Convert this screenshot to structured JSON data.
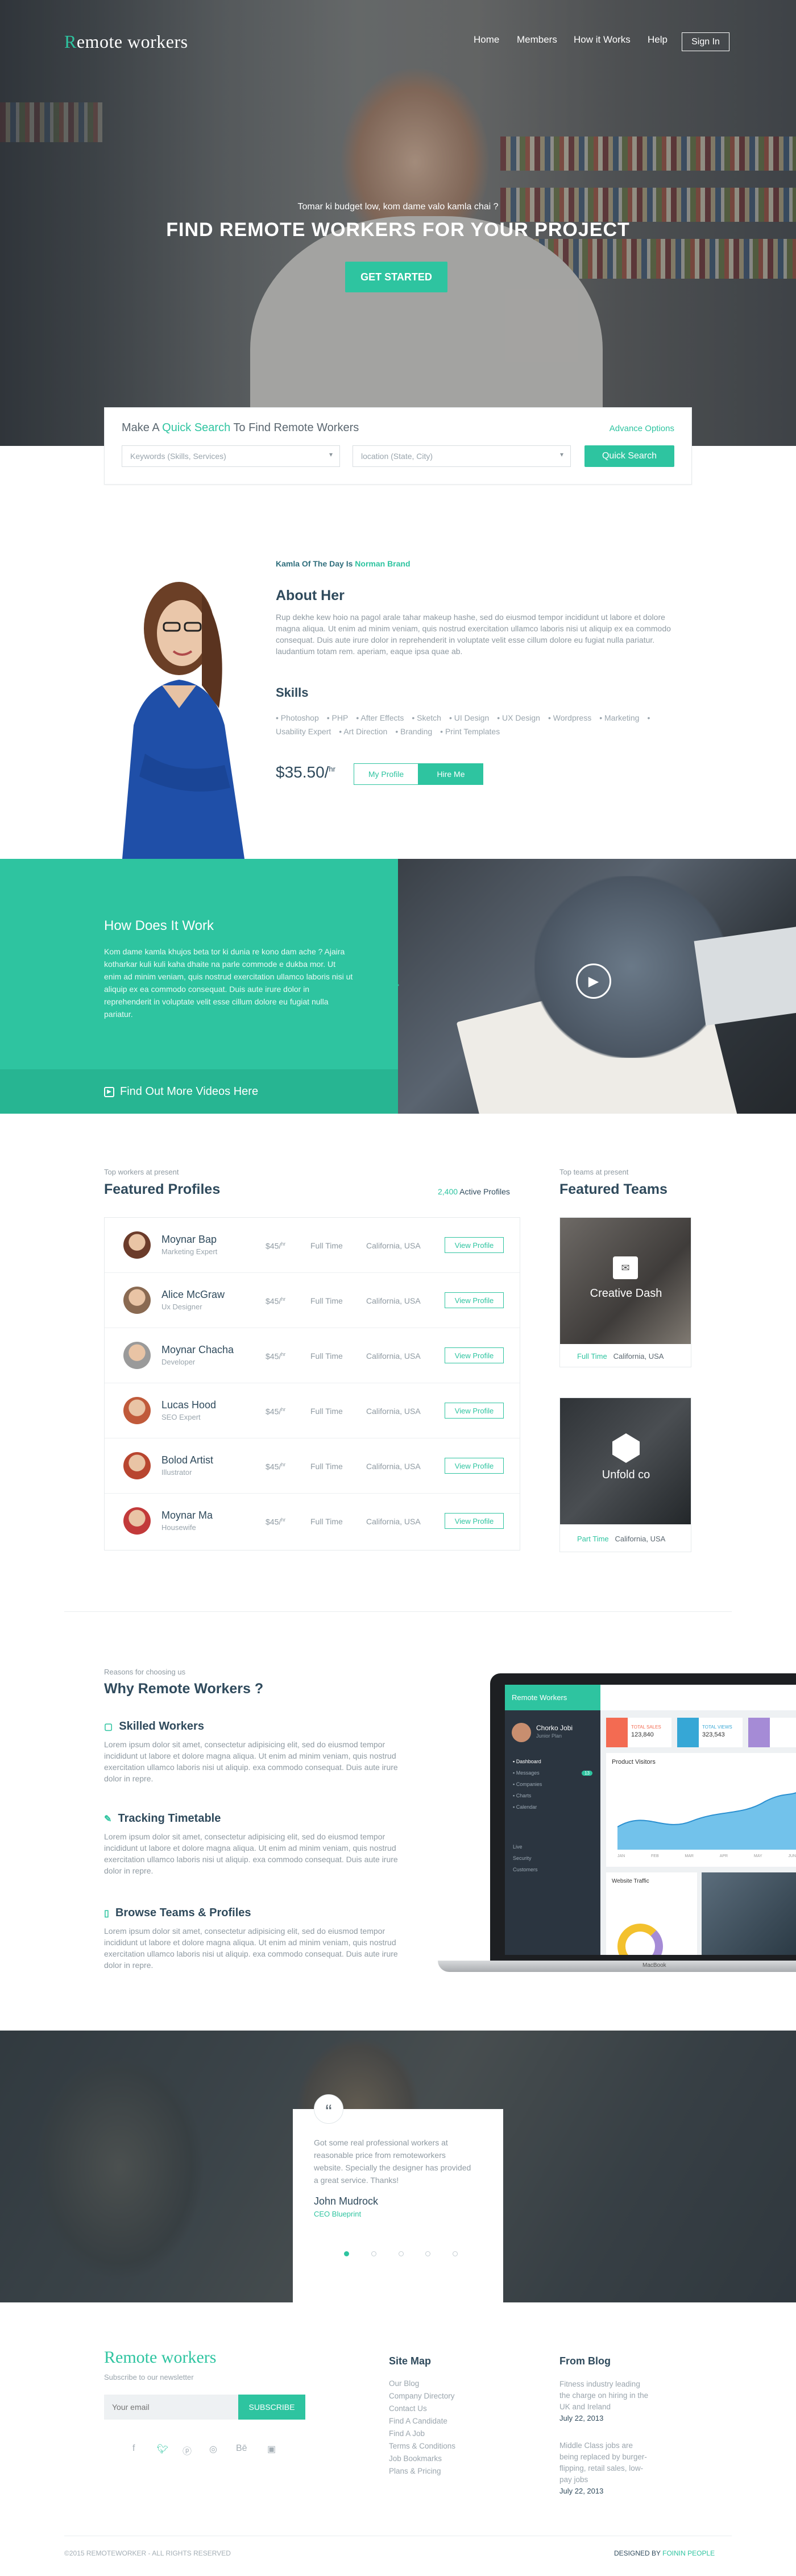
{
  "brand": {
    "first_letter": "R",
    "rest": "emote workers",
    "accent": "#2ec4a0",
    "dark": "#2f4a5c"
  },
  "nav": {
    "home": "Home",
    "members": "Members",
    "how": "How it Works",
    "help": "Help",
    "signin": "Sign In"
  },
  "hero": {
    "subtitle": "Tomar ki budget low, kom dame valo kamla chai ?",
    "title": "FIND REMOTE WORKERS FOR YOUR PROJECT",
    "cta": "GET STARTED"
  },
  "search": {
    "title_pre": "Make A ",
    "title_mid": "Quick Search",
    "title_post": " To Find Remote Workers",
    "advance": "Advance Options",
    "keywords_placeholder": "Keywords (Skills, Services)",
    "location_placeholder": "location (State, City)",
    "button": "Quick Search"
  },
  "kamla": {
    "label_pre": "Kamla Of The Day Is ",
    "name": "Norman Brand",
    "about_title": "About Her",
    "about_text": "Rup dekhe kew hoio na pagol arale tahar makeup hashe, sed do eiusmod tempor incididunt ut labore et dolore magna aliqua. Ut enim ad minim veniam, quis nostrud exercitation ullamco laboris nisi ut aliquip ex ea commodo consequat. Duis aute irure dolor in reprehenderit in voluptate velit esse cillum dolore eu fugiat nulla pariatur. laudantium totam rem. aperiam, eaque ipsa quae ab.",
    "skills_title": "Skills",
    "skills": [
      "Photoshop",
      "PHP",
      "After Effects",
      "Sketch",
      "UI Design",
      "UX Design",
      "Wordpress",
      "Marketing",
      "Usability Expert",
      "Art Direction",
      "Branding",
      "Print Templates"
    ],
    "price": "$35.50/",
    "price_unit": "hr",
    "my_profile": "My Profile",
    "hire_me": "Hire Me"
  },
  "how": {
    "title": "How Does It Work",
    "text": "Kom dame kamla khujos beta tor ki dunia re kono dam ache ? Ajaira kotharkar kuli kuli kaha dhaite na parle commode e dukba mor. Ut enim ad minim veniam, quis nostrud exercitation ullamco laboris nisi ut aliquip ex ea commodo consequat. Duis aute irure dolor in reprehenderit in voluptate velit esse cillum dolore eu fugiat nulla pariatur.",
    "videos": "Find Out More Videos Here"
  },
  "featured": {
    "small": "Top workers at present",
    "title": "Featured Profiles",
    "count": "2,400",
    "count_label": " Active Profiles",
    "rows": [
      {
        "name": "Moynar Bap",
        "role": "Marketing Expert",
        "rate": "$45/",
        "unit": "hr",
        "type": "Full Time",
        "loc": "California, USA",
        "btn": "View Profile",
        "color": "#6b3b2a"
      },
      {
        "name": "Alice McGraw",
        "role": "Ux Designer",
        "rate": "$45/",
        "unit": "hr",
        "type": "Full Time",
        "loc": "California, USA",
        "btn": "View Profile",
        "color": "#8a6a52"
      },
      {
        "name": "Moynar Chacha",
        "role": "Developer",
        "rate": "$45/",
        "unit": "hr",
        "type": "Full Time",
        "loc": "California, USA",
        "btn": "View Profile",
        "color": "#9a9a9a"
      },
      {
        "name": "Lucas Hood",
        "role": "SEO Expert",
        "rate": "$45/",
        "unit": "hr",
        "type": "Full Time",
        "loc": "California, USA",
        "btn": "View Profile",
        "color": "#c05a3a"
      },
      {
        "name": "Bolod Artist",
        "role": "Illustrator",
        "rate": "$45/",
        "unit": "hr",
        "type": "Full Time",
        "loc": "California, USA",
        "btn": "View Profile",
        "color": "#b8452f"
      },
      {
        "name": "Moynar Ma",
        "role": "Housewife",
        "rate": "$45/",
        "unit": "hr",
        "type": "Full Time",
        "loc": "California, USA",
        "btn": "View Profile",
        "color": "#c23a3a"
      }
    ]
  },
  "teams": {
    "small": "Top teams at present",
    "title": "Featured Teams",
    "items": [
      {
        "name": "Creative Dash",
        "type": "Full Time",
        "loc": "California, USA"
      },
      {
        "name": "Unfold co",
        "type": "Part Time",
        "loc": "California, USA"
      }
    ]
  },
  "why": {
    "small": "Reasons for choosing us",
    "title": "Why Remote Workers ?",
    "items": [
      {
        "title": "Skilled Workers",
        "text": "Lorem ipsum dolor sit amet, consectetur adipisicing elit, sed do eiusmod tempor incididunt ut labore et dolore magna aliqua. Ut enim ad minim veniam, quis nostrud exercitation ullamco laboris nisi ut aliquip. exa commodo consequat. Duis aute irure dolor in repre."
      },
      {
        "title": "Tracking Timetable",
        "text": "Lorem ipsum dolor sit amet, consectetur adipisicing elit, sed do eiusmod tempor incididunt ut labore et dolore magna aliqua. Ut enim ad minim veniam, quis nostrud exercitation ullamco laboris nisi ut aliquip. exa commodo consequat. Duis aute irure dolor in repre."
      },
      {
        "title": "Browse Teams & Profiles",
        "text": "Lorem ipsum dolor sit amet, consectetur adipisicing elit, sed do eiusmod tempor incididunt ut labore et dolore magna aliqua. Ut enim ad minim veniam, quis nostrud exercitation ullamco laboris nisi ut aliquip. exa commodo consequat. Duis aute irure dolor in repre."
      }
    ]
  },
  "dashboard": {
    "brand": "Remote Workers",
    "user": "Chorko Jobi",
    "user_sub": "Junior Plan",
    "menu": [
      "Dashboard",
      "Messages",
      "Companies",
      "Charts",
      "Calendar"
    ],
    "menu_badge": "13",
    "menu2": [
      "Live",
      "Security",
      "Customers"
    ],
    "stats": [
      {
        "label": "TOTAL SALES",
        "value": "123,840"
      },
      {
        "label": "TOTAL VIEWS",
        "value": "323,543"
      }
    ],
    "chart_title": "Product Visitors",
    "months": [
      "JAN",
      "FEB",
      "MAR",
      "APR",
      "MAY",
      "JUN"
    ],
    "traffic": "Website Traffic",
    "device": "MacBook"
  },
  "testimonial": {
    "quote_mark": "“",
    "text": "Got some real professional workers at reasonable price from remoteworkers website. Specially the designer has provided a great service. Thanks!",
    "name": "John Mudrock",
    "role": "CEO Blueprint"
  },
  "footer": {
    "brand": "Remote workers",
    "subscribe_label": "Subscribe to our newsletter",
    "email_placeholder": "Your email",
    "subscribe_btn": "SUBSCRIBE",
    "sitemap_title": "Site Map",
    "sitemap": [
      "Our Blog",
      "Company Directory",
      "Contact Us",
      "Find A Candidate",
      "Find A Job",
      "Terms & Conditions",
      "Job Bookmarks",
      "Plans & Pricing"
    ],
    "blog_title": "From Blog",
    "posts": [
      {
        "title": "Fitness industry leading the charge on hiring in the UK and Ireland",
        "date": "July 22, 2013"
      },
      {
        "title": "Middle Class jobs are being replaced by burger-flipping, retail sales, low-pay jobs",
        "date": "July 22, 2013"
      }
    ],
    "copyright": "©2015 REMOTEWORKER - ALL RIGHTS RESERVED",
    "designed_pre": "DESIGNED BY ",
    "designer": "FOININ PEOPLE"
  }
}
